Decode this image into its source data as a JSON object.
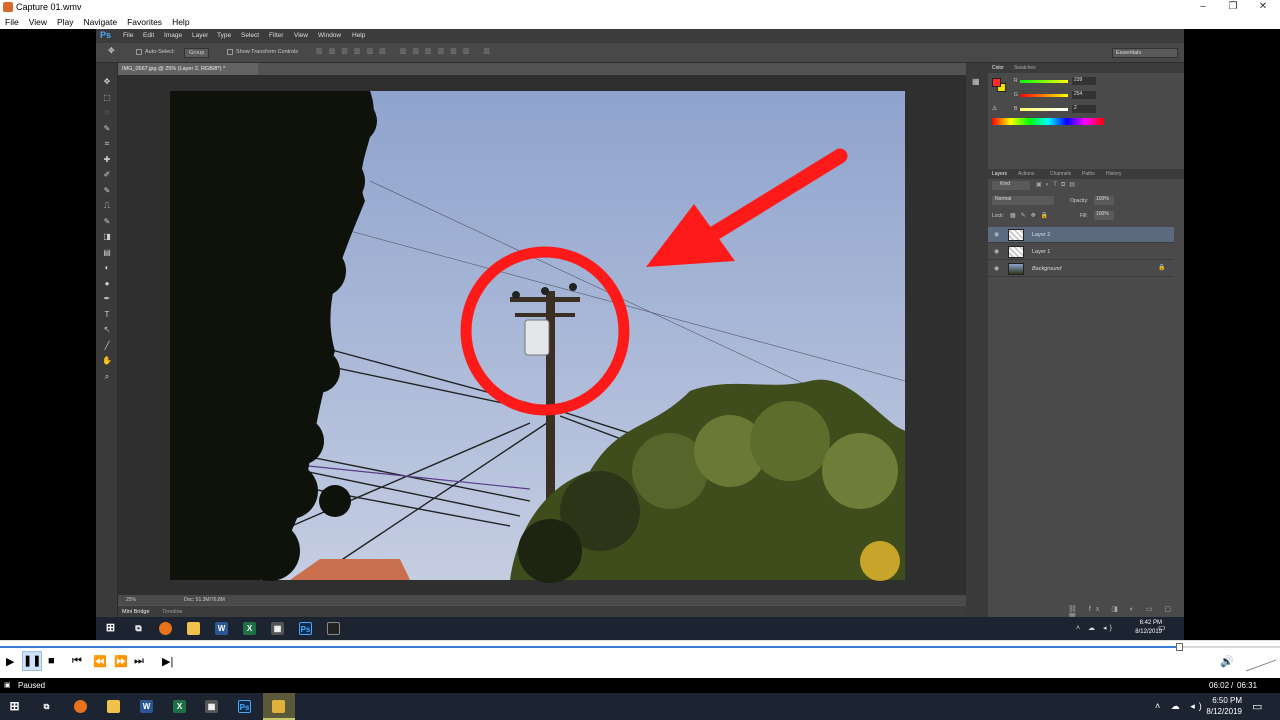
{
  "window": {
    "title": "Capture 01.wmv",
    "controls": [
      "–",
      "❐",
      "✕"
    ]
  },
  "menu": [
    "File",
    "View",
    "Play",
    "Navigate",
    "Favorites",
    "Help"
  ],
  "photoshop": {
    "logo": "Ps",
    "menus": [
      "File",
      "Edit",
      "Image",
      "Layer",
      "Type",
      "Select",
      "Filter",
      "View",
      "Window",
      "Help"
    ],
    "options": {
      "auto_select": "Auto-Select:",
      "group": "Group",
      "show_transform": "Show Transform Controls",
      "workspace": "Essentials"
    },
    "document_tab": "IMG_0567.jpg @ 25% (Layer 2, RGB/8*) *",
    "status": {
      "zoom": "25%",
      "doc": "Doc: 51.3M/76.8M"
    },
    "bottom_tabs": [
      "Mini Bridge",
      "Timeline"
    ],
    "color_panel": {
      "tabs": [
        "Color",
        "Swatches"
      ],
      "r": "239",
      "g": "254",
      "b": "2",
      "labels": [
        "R",
        "G",
        "B"
      ]
    },
    "layers_panel": {
      "tabs": [
        "Layers",
        "Actions",
        "Channels",
        "Paths",
        "History"
      ],
      "kind": "Kind",
      "blend": "Normal",
      "opacity_label": "Opacity:",
      "opacity": "100%",
      "lock_label": "Lock:",
      "fill_label": "Fill:",
      "fill": "100%",
      "layers": [
        {
          "name": "Layer 2"
        },
        {
          "name": "Layer 1"
        },
        {
          "name": "Background"
        }
      ]
    }
  },
  "inner_taskbar": {
    "time": "6:42 PM",
    "date": "8/12/2019"
  },
  "player": {
    "status": "Paused",
    "position": "06:02",
    "duration": "06:31",
    "separator": "/"
  },
  "outer_taskbar": {
    "time": "6:50 PM",
    "date": "8/12/2019"
  },
  "colors": {
    "annotation": "#ff1a1a",
    "sky_top": "#8fa6cf",
    "foreground": "#ff2a2a",
    "background_swatch": "#f2e600"
  }
}
